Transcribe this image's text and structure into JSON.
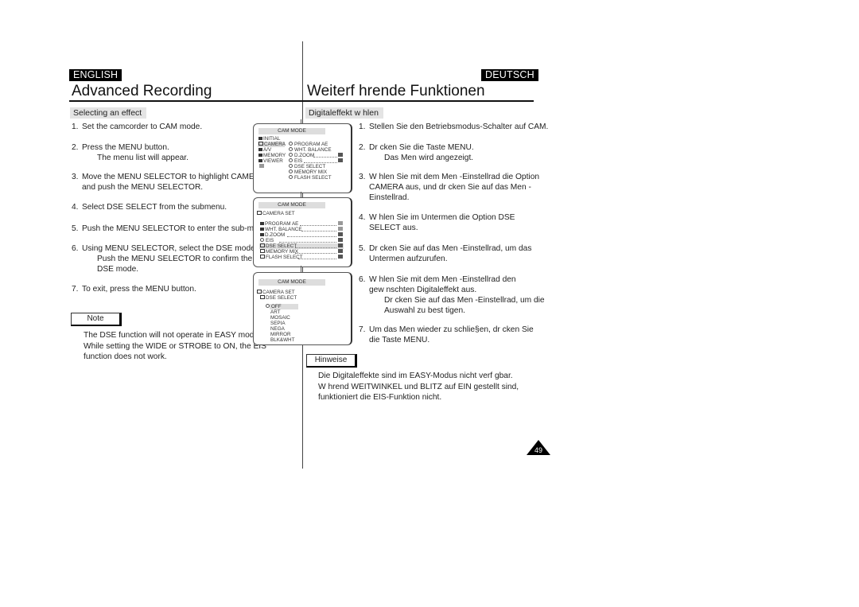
{
  "languages": {
    "left": "ENGLISH",
    "right": "DEUTSCH"
  },
  "titles": {
    "left": "Advanced Recording",
    "right": "Weiterf hrende Funktionen"
  },
  "subheads": {
    "left": "Selecting an effect",
    "right": "Digitaleffekt w hlen"
  },
  "english_steps": [
    {
      "num": "1.",
      "lines": [
        "Set the camcorder to CAM mode."
      ]
    },
    {
      "num": "2.",
      "lines": [
        "Press the MENU button."
      ],
      "sub": [
        "The menu list will appear."
      ]
    },
    {
      "num": "3.",
      "lines": [
        "Move the MENU SELECTOR to highlight CAMERA",
        "and push the MENU SELECTOR."
      ]
    },
    {
      "num": "4.",
      "lines": [
        "Select DSE SELECT from the submenu."
      ]
    },
    {
      "num": "5.",
      "lines": [
        "Push the MENU SELECTOR to enter the sub-menu."
      ]
    },
    {
      "num": "6.",
      "lines": [
        "Using MENU SELECTOR, select the DSE mode."
      ],
      "sub": [
        "Push the MENU SELECTOR to confirm the",
        "DSE mode."
      ]
    },
    {
      "num": "7.",
      "lines": [
        "To exit, press the MENU button."
      ]
    }
  ],
  "german_steps": [
    {
      "num": "1.",
      "lines": [
        "Stellen Sie den Betriebsmodus-Schalter auf CAM."
      ]
    },
    {
      "num": "2.",
      "lines": [
        "Dr  cken Sie die Taste MENU."
      ],
      "sub": [
        "Das Men   wird angezeigt."
      ]
    },
    {
      "num": "3.",
      "lines": [
        "W  hlen Sie mit dem Men  -Einstellrad die Option",
        "CAMERA aus, und dr  cken Sie auf das Men  -",
        "Einstellrad."
      ]
    },
    {
      "num": "4.",
      "lines": [
        "W  hlen Sie im Untermen   die Option DSE",
        "SELECT aus."
      ]
    },
    {
      "num": "5.",
      "lines": [
        "Dr  cken Sie auf das Men  -Einstellrad, um das",
        "Untermen   aufzurufen."
      ]
    },
    {
      "num": "6.",
      "lines": [
        "W  hlen Sie mit dem Men  -Einstellrad den",
        "gew  nschten Digitaleffekt aus."
      ],
      "sub": [
        "Dr  cken Sie auf das Men  -Einstellrad, um die",
        "Auswahl zu best  tigen."
      ]
    },
    {
      "num": "7.",
      "lines": [
        "Um das Men   wieder zu schlie§en, dr  cken Sie",
        "die Taste MENU."
      ]
    }
  ],
  "note": {
    "label": "Note",
    "lines": [
      "The DSE function will not operate in EASY mode.",
      "While setting the WIDE or STROBE to ON, the EIS",
      "function does not work."
    ]
  },
  "hinweise": {
    "label": "Hinweise",
    "lines": [
      "Die Digitaleffekte sind im EASY-Modus nicht verf  gbar.",
      "W  hrend WEITWINKEL und BLITZ auf EIN gestellt sind,",
      "funktioniert die EIS-Funktion nicht."
    ]
  },
  "screens": [
    {
      "header": "CAM  MODE",
      "main_menu": [
        "INITIAL",
        "CAMERA",
        "A/V",
        "MEMORY",
        "VIEWER"
      ],
      "selected_main": "CAMERA",
      "sub_menu": [
        "PROGRAM AE",
        "WHT. BALANCE",
        "D.ZOOM",
        "EIS",
        "DSE SELECT",
        "MEMORY MIX",
        "FLASH SELECT"
      ]
    },
    {
      "header": "CAM  MODE",
      "path": "CAMERA SET",
      "items": [
        "PROGRAM AE",
        "WHT. BALANCE",
        "D.ZOOM",
        "EIS",
        "DSE SELECT",
        "MEMORY MIX",
        "FLASH SELECT"
      ],
      "selected": "DSE SELECT"
    },
    {
      "header": "CAM  MODE",
      "path": "CAMERA SET",
      "subpath": "DSE SELECT",
      "options": [
        "OFF",
        "ART",
        "MOSAIC",
        "SEPIA",
        "NEGA",
        "MIRROR",
        "BLK&WHT"
      ],
      "selected": "OFF"
    }
  ],
  "page_number": "49"
}
